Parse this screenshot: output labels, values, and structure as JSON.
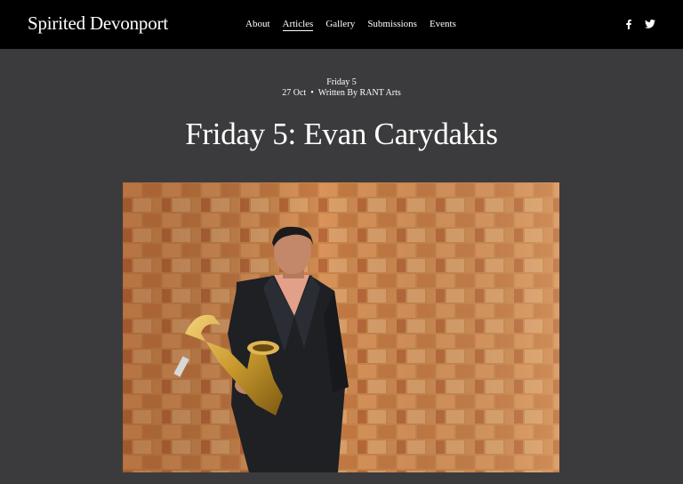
{
  "site": {
    "title": "Spirited Devonport"
  },
  "nav": {
    "items": [
      {
        "label": "About",
        "active": false
      },
      {
        "label": "Articles",
        "active": true
      },
      {
        "label": "Gallery",
        "active": false
      },
      {
        "label": "Submissions",
        "active": false
      },
      {
        "label": "Events",
        "active": false
      }
    ]
  },
  "social": {
    "icons": [
      "facebook-icon",
      "twitter-icon"
    ]
  },
  "article": {
    "category": "Friday 5",
    "date": "27 Oct",
    "separator": "•",
    "byline": "Written By RANT Arts",
    "title": "Friday 5: Evan Carydakis"
  },
  "colors": {
    "header_bg": "#000000",
    "page_bg": "#3b3b3d",
    "text": "#ffffff"
  }
}
